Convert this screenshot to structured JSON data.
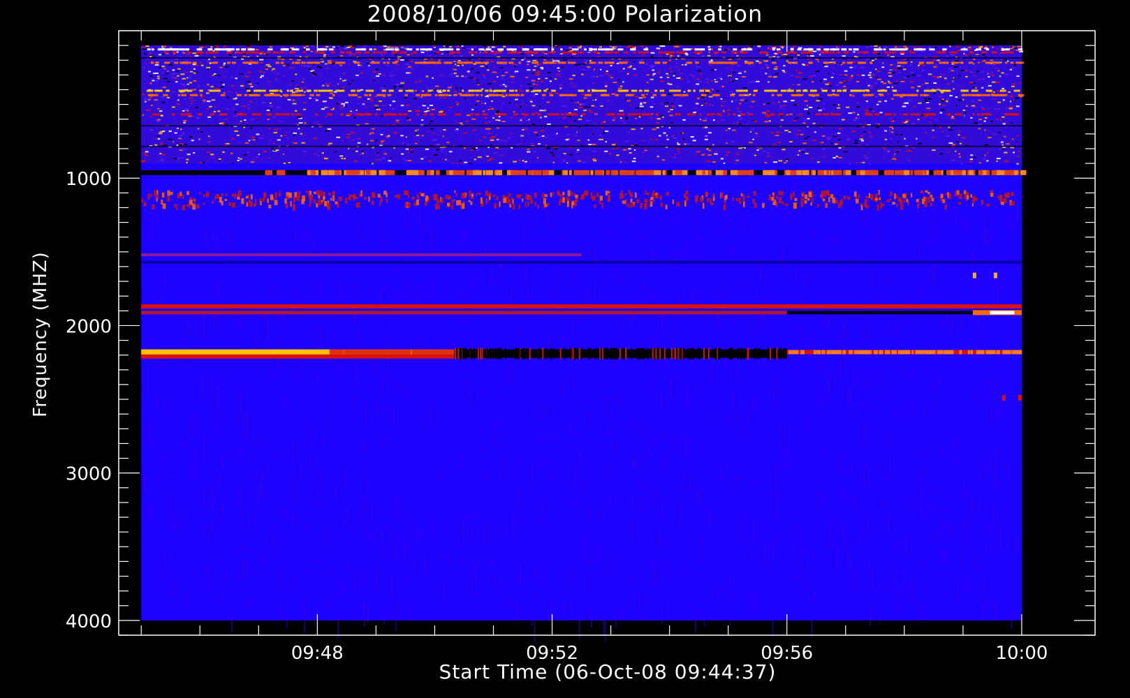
{
  "chart_data": {
    "type": "heatmap",
    "title": "2008/10/06 09:45:00 Polarization",
    "xlabel": "Start Time (06-Oct-08 09:44:37)",
    "ylabel": "Frequency (MHZ)",
    "x_tick_labels": [
      "09:48",
      "09:52",
      "09:56",
      "10:00"
    ],
    "x_ticks": [
      "09:48",
      "09:52",
      "09:56",
      "10:00"
    ],
    "xlim": [
      "09:44:37",
      "10:01:15"
    ],
    "data_x_range": [
      "09:45:00",
      "10:00:00"
    ],
    "y_ticks": [
      1000,
      2000,
      3000,
      4000
    ],
    "y_tick_labels": [
      "1000",
      "2000",
      "3000",
      "4000"
    ],
    "ylim": [
      4100,
      0
    ],
    "data_y_range": [
      100,
      4000
    ],
    "y_inverted": true,
    "colormap": [
      "#000000",
      "#1e00ff",
      "#7a10a0",
      "#d81010",
      "#ff6a00",
      "#ffd200",
      "#ffffff"
    ],
    "background_level": "blue (low)",
    "features": [
      {
        "kind": "noise-band",
        "freq_range": [
          100,
          900
        ],
        "intensity": "mixed red/orange/yellow speckle"
      },
      {
        "kind": "line",
        "freq": 960,
        "t_start": "09:45:00",
        "t_end": "10:00:00",
        "intensity": "dark early, red/orange from 09:47"
      },
      {
        "kind": "speckle",
        "freq_range": [
          1080,
          1180
        ],
        "intensity": "scattered red"
      },
      {
        "kind": "line",
        "freq": 1520,
        "t_start": "09:45:00",
        "t_end": "09:52:30",
        "intensity": "faint red"
      },
      {
        "kind": "line",
        "freq": 1570,
        "t_start": "09:45:00",
        "t_end": "10:00:00",
        "intensity": "dark blue"
      },
      {
        "kind": "dots",
        "freq": 1660,
        "t_start": "09:59:10",
        "t_end": "09:59:35",
        "intensity": "orange/yellow"
      },
      {
        "kind": "line",
        "freq": 1870,
        "t_start": "09:45:00",
        "t_end": "10:00:00",
        "intensity": "red"
      },
      {
        "kind": "line",
        "freq": 1910,
        "t_start": "09:45:00",
        "t_end": "09:59:10",
        "intensity": "red, dark after 09:56"
      },
      {
        "kind": "burst",
        "freq": 1910,
        "t_start": "09:59:10",
        "t_end": "10:00:00",
        "intensity": "orange to white"
      },
      {
        "kind": "line",
        "freq": 2180,
        "t_start": "09:45:00",
        "t_end": "09:50:20",
        "intensity": "yellow/orange bright"
      },
      {
        "kind": "line",
        "freq": 2210,
        "t_start": "09:45:00",
        "t_end": "09:50:20",
        "intensity": "red"
      },
      {
        "kind": "line",
        "freq": 2190,
        "t_start": "09:50:20",
        "t_end": "09:56:00",
        "intensity": "dark/black"
      },
      {
        "kind": "line",
        "freq": 2180,
        "t_start": "09:56:00",
        "t_end": "10:00:00",
        "intensity": "red"
      },
      {
        "kind": "dots",
        "freq": 2490,
        "t_start": "09:59:40",
        "t_end": "10:00:00",
        "intensity": "red"
      }
    ]
  }
}
